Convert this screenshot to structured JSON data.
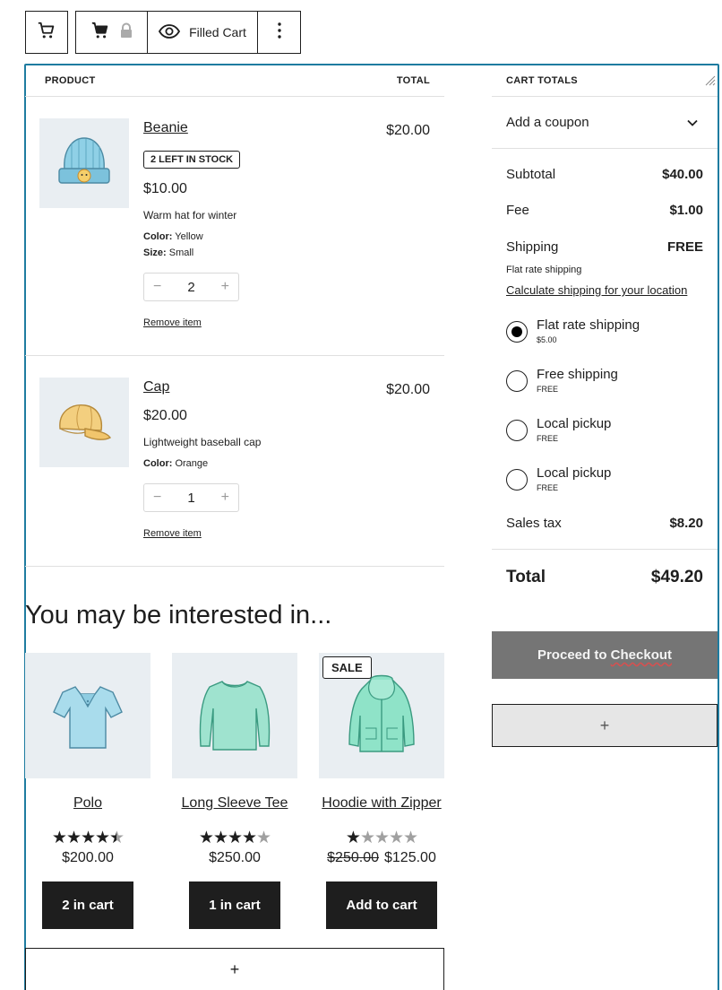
{
  "toolbar": {
    "icons": [
      "cart-icon",
      "cart-icon",
      "lock-icon",
      "eye-icon",
      "more-vertical-icon"
    ],
    "view_label": "Filled Cart"
  },
  "cart": {
    "headers": {
      "product": "PRODUCT",
      "total": "TOTAL"
    },
    "items": [
      {
        "name": "Beanie",
        "badge": "2 LEFT IN STOCK",
        "price": "$10.00",
        "description": "Warm hat for winter",
        "meta": [
          {
            "label": "Color:",
            "value": "Yellow"
          },
          {
            "label": "Size:",
            "value": "Small"
          }
        ],
        "quantity": "2",
        "total": "$20.00",
        "remove_label": "Remove item",
        "decrement": "−",
        "increment": "+"
      },
      {
        "name": "Cap",
        "price": "$20.00",
        "description": "Lightweight baseball cap",
        "meta": [
          {
            "label": "Color:",
            "value": "Orange"
          }
        ],
        "quantity": "1",
        "total": "$20.00",
        "remove_label": "Remove item",
        "decrement": "−",
        "increment": "+"
      }
    ]
  },
  "cross_sells": {
    "title": "You may be interested in...",
    "products": [
      {
        "name": "Polo",
        "rating": 4.5,
        "price": "$200.00",
        "button": "2 in cart"
      },
      {
        "name": "Long Sleeve Tee",
        "rating": 4,
        "price": "$250.00",
        "button": "1 in cart"
      },
      {
        "name": "Hoodie with Zipper",
        "rating": 1,
        "sale_badge": "SALE",
        "regular_price": "$250.00",
        "price": "$125.00",
        "button": "Add to cart"
      }
    ],
    "add_block": "+"
  },
  "totals": {
    "header": "CART TOTALS",
    "coupon_label": "Add a coupon",
    "subtotal": {
      "label": "Subtotal",
      "value": "$40.00"
    },
    "fee": {
      "label": "Fee",
      "value": "$1.00"
    },
    "shipping": {
      "label": "Shipping",
      "value": "FREE",
      "method": "Flat rate shipping",
      "calc_link": "Calculate shipping for your location"
    },
    "options": [
      {
        "label": "Flat rate shipping",
        "price": "$5.00",
        "selected": true
      },
      {
        "label": "Free shipping",
        "price": "FREE",
        "selected": false
      },
      {
        "label": "Local pickup",
        "price": "FREE",
        "selected": false
      },
      {
        "label": "Local pickup",
        "price": "FREE",
        "selected": false
      }
    ],
    "tax": {
      "label": "Sales tax",
      "value": "$8.20"
    },
    "total": {
      "label": "Total",
      "value": "$49.20"
    },
    "checkout_word1": "Proceed to",
    "checkout_word2": "Checkout",
    "add_block": "+"
  }
}
